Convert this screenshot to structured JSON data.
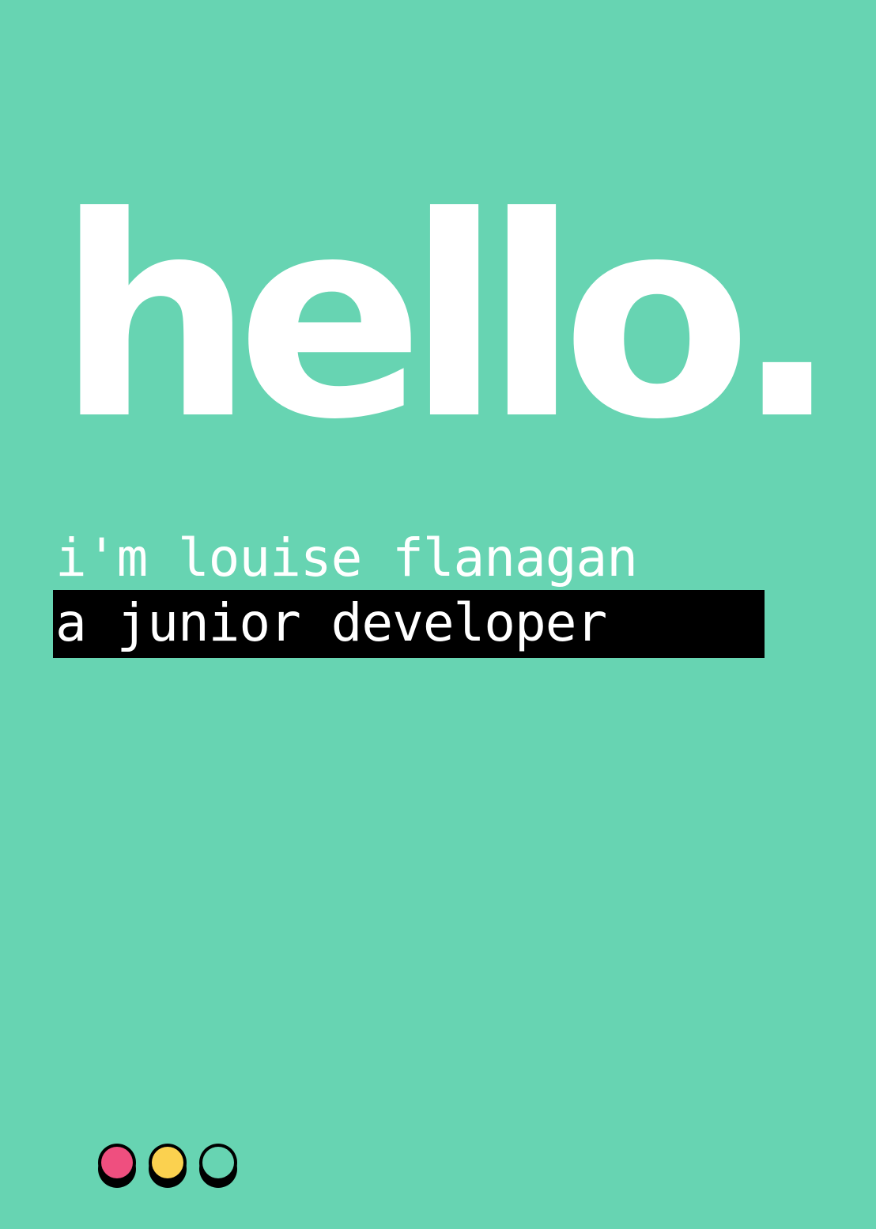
{
  "hero": {
    "headline": "hello.",
    "intro": "i'm louise flanagan",
    "role": "a junior developer"
  },
  "window_controls": {
    "icons": [
      "close-dot-icon",
      "minimize-dot-icon",
      "maximize-dot-icon"
    ],
    "colors": {
      "close": "#ef4f7f",
      "minimize": "#fbd14f",
      "maximize": "#67d4b2"
    }
  },
  "theme": {
    "background": "#67d4b2",
    "text": "#ffffff",
    "highlight": "#000000"
  }
}
